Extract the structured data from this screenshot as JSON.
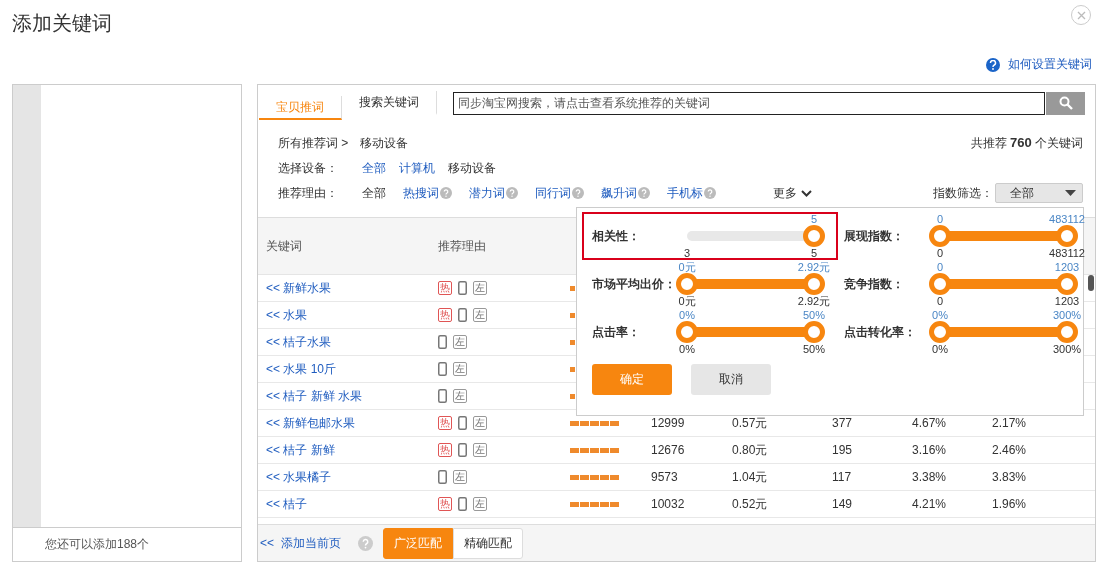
{
  "window": {
    "title": "添加关键词"
  },
  "help_link": "如何设置关键词",
  "left_panel": {
    "footer": "您还可以添加188个"
  },
  "tabs": [
    {
      "label": "宝贝推词",
      "selected": true
    },
    {
      "label": "搜索关键词",
      "selected": false
    }
  ],
  "search": {
    "placeholder": "同步淘宝网搜索，请点击查看系统推荐的关键词"
  },
  "breadcrumb": {
    "root": "所有推荐词 >",
    "current": "移动设备"
  },
  "total": "共推荐 **760** 个关键词",
  "device_filter": {
    "label": "选择设备：",
    "options": [
      {
        "label": "全部",
        "selected": false
      },
      {
        "label": "计算机",
        "selected": false
      },
      {
        "label": "移动设备",
        "selected": true
      }
    ]
  },
  "reason_filter": {
    "label": "推荐理由：",
    "options": [
      {
        "label": "全部",
        "selected": true,
        "help": false
      },
      {
        "label": "热搜词",
        "selected": false,
        "help": true
      },
      {
        "label": "潜力词",
        "selected": false,
        "help": true
      },
      {
        "label": "同行词",
        "selected": false,
        "help": true
      },
      {
        "label": "飙升词",
        "selected": false,
        "help": true
      },
      {
        "label": "手机标",
        "selected": false,
        "help": true
      }
    ],
    "more": "更多"
  },
  "index_filter": {
    "label": "指数筛选：",
    "value": "全部"
  },
  "table": {
    "columns": [
      "关键词",
      "推荐理由"
    ],
    "rows": [
      {
        "keyword": "<< 新鲜水果",
        "tags": [
          {
            "kind": "hot",
            "text": "热"
          },
          {
            "kind": "mobile"
          },
          {
            "kind": "mark",
            "text": "左"
          }
        ]
      },
      {
        "keyword": "<< 水果",
        "tags": [
          {
            "kind": "hot",
            "text": "热"
          },
          {
            "kind": "mobile"
          },
          {
            "kind": "mark",
            "text": "左"
          }
        ]
      },
      {
        "keyword": "<< 桔子水果",
        "tags": [
          {
            "kind": "mobile"
          },
          {
            "kind": "mark",
            "text": "左"
          }
        ]
      },
      {
        "keyword": "<< 水果 10斤",
        "tags": [
          {
            "kind": "mobile"
          },
          {
            "kind": "mark",
            "text": "左"
          }
        ]
      },
      {
        "keyword": "<< 桔子 新鲜 水果",
        "tags": [
          {
            "kind": "mobile"
          },
          {
            "kind": "mark",
            "text": "左"
          }
        ]
      },
      {
        "keyword": "<< 新鲜包邮水果",
        "tags": [
          {
            "kind": "hot",
            "text": "热"
          },
          {
            "kind": "mobile"
          },
          {
            "kind": "mark",
            "text": "左"
          }
        ],
        "cells": [
          "12999",
          "0.57元",
          "377",
          "4.67%",
          "2.17%"
        ]
      },
      {
        "keyword": "<< 桔子 新鲜",
        "tags": [
          {
            "kind": "hot",
            "text": "热"
          },
          {
            "kind": "mobile"
          },
          {
            "kind": "mark",
            "text": "左"
          }
        ],
        "cells": [
          "12676",
          "0.80元",
          "195",
          "3.16%",
          "2.46%"
        ]
      },
      {
        "keyword": "<< 水果橘子",
        "tags": [
          {
            "kind": "mobile"
          },
          {
            "kind": "mark",
            "text": "左"
          }
        ],
        "cells": [
          "9573",
          "1.04元",
          "117",
          "3.38%",
          "3.83%"
        ]
      },
      {
        "keyword": "<< 桔子",
        "tags": [
          {
            "kind": "hot",
            "text": "热"
          },
          {
            "kind": "mobile"
          },
          {
            "kind": "mark",
            "text": "左"
          }
        ],
        "cells": [
          "10032",
          "0.52元",
          "149",
          "4.21%",
          "1.96%"
        ]
      }
    ]
  },
  "footer": {
    "add_page": "<<  添加当前页",
    "match": [
      {
        "label": "广泛匹配",
        "selected": true
      },
      {
        "label": "精确匹配",
        "selected": false
      }
    ]
  },
  "filter_popup": {
    "sliders": [
      {
        "kind": "single",
        "label": "相关性：",
        "highlighted": true,
        "level": 1,
        "high_value": "5",
        "min_label": "3",
        "max_label": "5"
      },
      {
        "kind": "range",
        "label": "展现指数：",
        "highlighted": false,
        "level": 1,
        "low_value": "0",
        "high_value": "483112",
        "min_label": "0",
        "max_label": "483112"
      },
      {
        "kind": "range",
        "label": "市场平均出价：",
        "highlighted": false,
        "level": 1,
        "low_value": "0元",
        "high_value": "2.92元",
        "min_label": "0元",
        "max_label": "2.92元"
      },
      {
        "kind": "range",
        "label": "竞争指数：",
        "highlighted": false,
        "level": 1,
        "low_value": "0",
        "high_value": "1203",
        "min_label": "0",
        "max_label": "1203"
      },
      {
        "kind": "range",
        "label": "点击率：",
        "highlighted": false,
        "level": 1,
        "low_value": "0%",
        "high_value": "50%",
        "min_label": "0%",
        "max_label": "50%"
      },
      {
        "kind": "range",
        "label": "点击转化率：",
        "highlighted": false,
        "level": 1,
        "low_value": "0%",
        "high_value": "300%",
        "min_label": "0%",
        "max_label": "300%"
      }
    ],
    "confirm": "确定",
    "cancel": "取消"
  }
}
